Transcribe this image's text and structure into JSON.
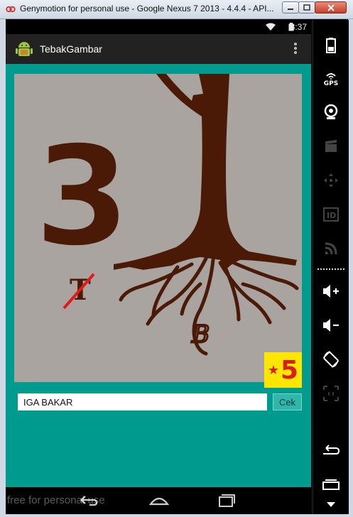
{
  "window": {
    "title": "Genymotion for personal use - Google Nexus 7 2013 - 4.4.4 - API..."
  },
  "status_bar": {
    "clock": "8:37"
  },
  "action_bar": {
    "app_title": "TebakGambar"
  },
  "puzzle": {
    "level": "5",
    "image_text": "3",
    "struck_letter": "T",
    "root_letter": "B"
  },
  "answer": {
    "value": "IGA BAKAR",
    "check_label": "Cek"
  },
  "side_panel": {
    "gps_label": "GPS",
    "id_label": "ID"
  },
  "watermark": "free for personal use",
  "colors": {
    "app_background": "#009b8f",
    "puzzle_background": "#a9a4a0",
    "tree_brown": "#4b1a07",
    "badge_yellow": "#ffe600",
    "badge_red": "#d81e1e"
  }
}
